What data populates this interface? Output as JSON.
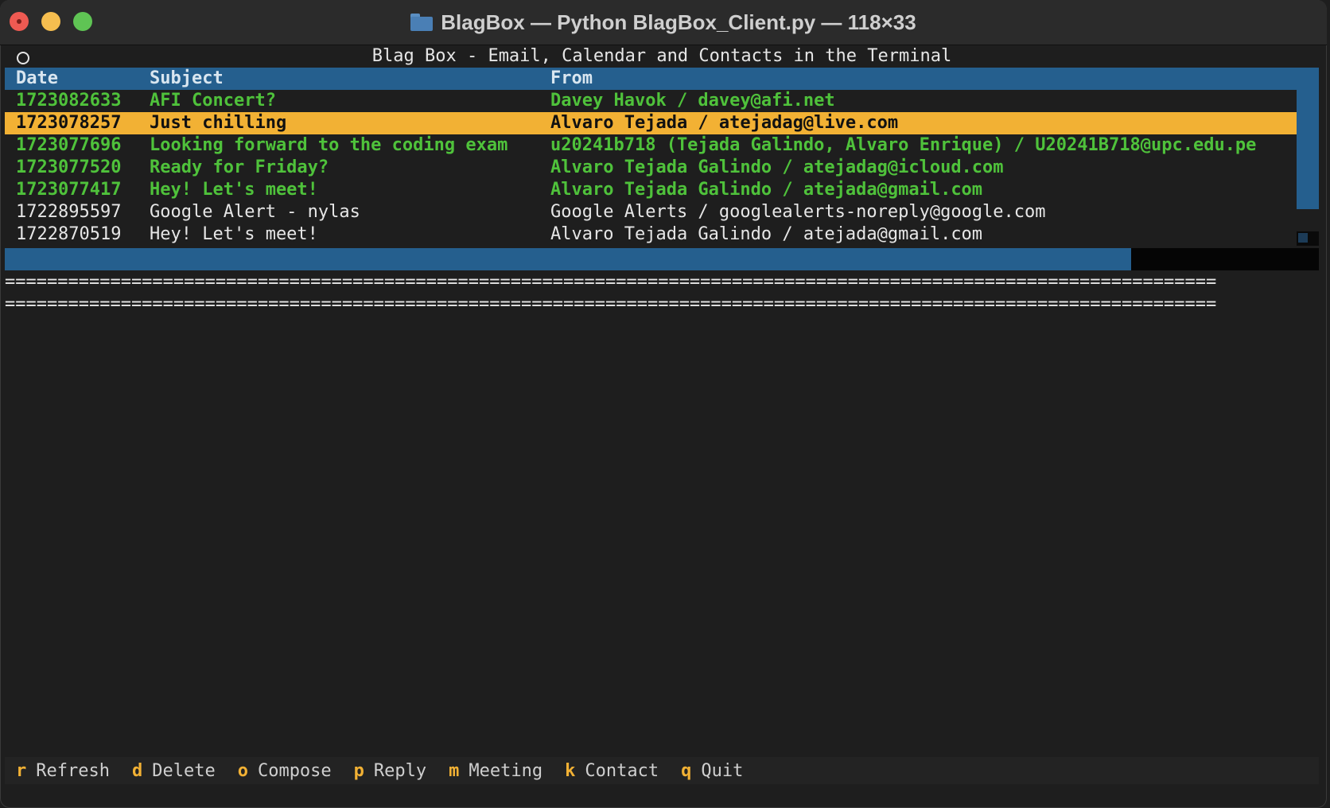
{
  "window": {
    "title": "BlagBox — Python BlagBox_Client.py — 118×33"
  },
  "app": {
    "title": "Blag Box - Email, Calendar and Contacts in the Terminal"
  },
  "table": {
    "headers": {
      "date": "Date",
      "subject": "Subject",
      "from": "From"
    },
    "rows": [
      {
        "date": "1723082633",
        "subject": "AFI Concert?",
        "from": "Davey Havok / davey@afi.net",
        "style": "unread"
      },
      {
        "date": "1723078257",
        "subject": "Just chilling",
        "from": "Alvaro Tejada / atejadag@live.com",
        "style": "selected"
      },
      {
        "date": "1723077696",
        "subject": "Looking forward to the coding exam",
        "from": "u20241b718 (Tejada Galindo, Alvaro Enrique) / U20241B718@upc.edu.pe",
        "style": "unread"
      },
      {
        "date": "1723077520",
        "subject": "Ready for Friday?",
        "from": "Alvaro Tejada Galindo / atejadag@icloud.com",
        "style": "unread"
      },
      {
        "date": "1723077417",
        "subject": "Hey! Let's meet!",
        "from": "Alvaro Tejada Galindo / atejada@gmail.com",
        "style": "unread"
      },
      {
        "date": "1722895597",
        "subject": "Google Alert - nylas",
        "from": "Google Alerts / googlealerts-noreply@google.com",
        "style": "read"
      },
      {
        "date": "1722870519",
        "subject": "Hey! Let's meet!",
        "from": "Alvaro Tejada Galindo / atejada@gmail.com",
        "style": "read"
      }
    ]
  },
  "separator": "===================================================================================================================",
  "footer": {
    "items": [
      {
        "key": "r",
        "label": "Refresh"
      },
      {
        "key": "d",
        "label": "Delete"
      },
      {
        "key": "o",
        "label": "Compose"
      },
      {
        "key": "p",
        "label": "Reply"
      },
      {
        "key": "m",
        "label": "Meeting"
      },
      {
        "key": "k",
        "label": "Contact"
      },
      {
        "key": "q",
        "label": "Quit"
      }
    ]
  },
  "colors": {
    "header_bg": "#255f8e",
    "selected_bg": "#f2b134",
    "unread_text": "#4fc23b",
    "hotkey": "#f2b134"
  }
}
